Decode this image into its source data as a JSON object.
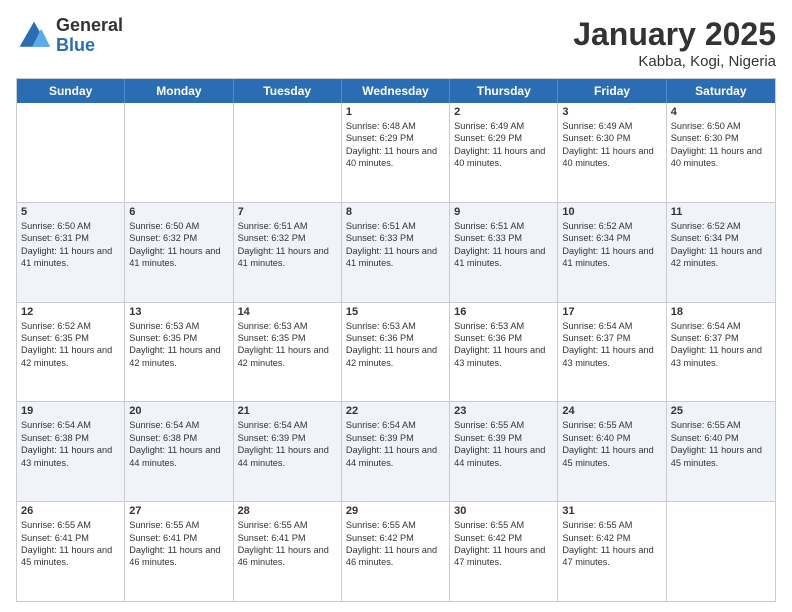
{
  "logo": {
    "general": "General",
    "blue": "Blue"
  },
  "title": "January 2025",
  "location": "Kabba, Kogi, Nigeria",
  "days_of_week": [
    "Sunday",
    "Monday",
    "Tuesday",
    "Wednesday",
    "Thursday",
    "Friday",
    "Saturday"
  ],
  "weeks": [
    [
      {
        "day": "",
        "text": ""
      },
      {
        "day": "",
        "text": ""
      },
      {
        "day": "",
        "text": ""
      },
      {
        "day": "1",
        "text": "Sunrise: 6:48 AM\nSunset: 6:29 PM\nDaylight: 11 hours and 40 minutes."
      },
      {
        "day": "2",
        "text": "Sunrise: 6:49 AM\nSunset: 6:29 PM\nDaylight: 11 hours and 40 minutes."
      },
      {
        "day": "3",
        "text": "Sunrise: 6:49 AM\nSunset: 6:30 PM\nDaylight: 11 hours and 40 minutes."
      },
      {
        "day": "4",
        "text": "Sunrise: 6:50 AM\nSunset: 6:30 PM\nDaylight: 11 hours and 40 minutes."
      }
    ],
    [
      {
        "day": "5",
        "text": "Sunrise: 6:50 AM\nSunset: 6:31 PM\nDaylight: 11 hours and 41 minutes."
      },
      {
        "day": "6",
        "text": "Sunrise: 6:50 AM\nSunset: 6:32 PM\nDaylight: 11 hours and 41 minutes."
      },
      {
        "day": "7",
        "text": "Sunrise: 6:51 AM\nSunset: 6:32 PM\nDaylight: 11 hours and 41 minutes."
      },
      {
        "day": "8",
        "text": "Sunrise: 6:51 AM\nSunset: 6:33 PM\nDaylight: 11 hours and 41 minutes."
      },
      {
        "day": "9",
        "text": "Sunrise: 6:51 AM\nSunset: 6:33 PM\nDaylight: 11 hours and 41 minutes."
      },
      {
        "day": "10",
        "text": "Sunrise: 6:52 AM\nSunset: 6:34 PM\nDaylight: 11 hours and 41 minutes."
      },
      {
        "day": "11",
        "text": "Sunrise: 6:52 AM\nSunset: 6:34 PM\nDaylight: 11 hours and 42 minutes."
      }
    ],
    [
      {
        "day": "12",
        "text": "Sunrise: 6:52 AM\nSunset: 6:35 PM\nDaylight: 11 hours and 42 minutes."
      },
      {
        "day": "13",
        "text": "Sunrise: 6:53 AM\nSunset: 6:35 PM\nDaylight: 11 hours and 42 minutes."
      },
      {
        "day": "14",
        "text": "Sunrise: 6:53 AM\nSunset: 6:35 PM\nDaylight: 11 hours and 42 minutes."
      },
      {
        "day": "15",
        "text": "Sunrise: 6:53 AM\nSunset: 6:36 PM\nDaylight: 11 hours and 42 minutes."
      },
      {
        "day": "16",
        "text": "Sunrise: 6:53 AM\nSunset: 6:36 PM\nDaylight: 11 hours and 43 minutes."
      },
      {
        "day": "17",
        "text": "Sunrise: 6:54 AM\nSunset: 6:37 PM\nDaylight: 11 hours and 43 minutes."
      },
      {
        "day": "18",
        "text": "Sunrise: 6:54 AM\nSunset: 6:37 PM\nDaylight: 11 hours and 43 minutes."
      }
    ],
    [
      {
        "day": "19",
        "text": "Sunrise: 6:54 AM\nSunset: 6:38 PM\nDaylight: 11 hours and 43 minutes."
      },
      {
        "day": "20",
        "text": "Sunrise: 6:54 AM\nSunset: 6:38 PM\nDaylight: 11 hours and 44 minutes."
      },
      {
        "day": "21",
        "text": "Sunrise: 6:54 AM\nSunset: 6:39 PM\nDaylight: 11 hours and 44 minutes."
      },
      {
        "day": "22",
        "text": "Sunrise: 6:54 AM\nSunset: 6:39 PM\nDaylight: 11 hours and 44 minutes."
      },
      {
        "day": "23",
        "text": "Sunrise: 6:55 AM\nSunset: 6:39 PM\nDaylight: 11 hours and 44 minutes."
      },
      {
        "day": "24",
        "text": "Sunrise: 6:55 AM\nSunset: 6:40 PM\nDaylight: 11 hours and 45 minutes."
      },
      {
        "day": "25",
        "text": "Sunrise: 6:55 AM\nSunset: 6:40 PM\nDaylight: 11 hours and 45 minutes."
      }
    ],
    [
      {
        "day": "26",
        "text": "Sunrise: 6:55 AM\nSunset: 6:41 PM\nDaylight: 11 hours and 45 minutes."
      },
      {
        "day": "27",
        "text": "Sunrise: 6:55 AM\nSunset: 6:41 PM\nDaylight: 11 hours and 46 minutes."
      },
      {
        "day": "28",
        "text": "Sunrise: 6:55 AM\nSunset: 6:41 PM\nDaylight: 11 hours and 46 minutes."
      },
      {
        "day": "29",
        "text": "Sunrise: 6:55 AM\nSunset: 6:42 PM\nDaylight: 11 hours and 46 minutes."
      },
      {
        "day": "30",
        "text": "Sunrise: 6:55 AM\nSunset: 6:42 PM\nDaylight: 11 hours and 47 minutes."
      },
      {
        "day": "31",
        "text": "Sunrise: 6:55 AM\nSunset: 6:42 PM\nDaylight: 11 hours and 47 minutes."
      },
      {
        "day": "",
        "text": ""
      }
    ]
  ]
}
